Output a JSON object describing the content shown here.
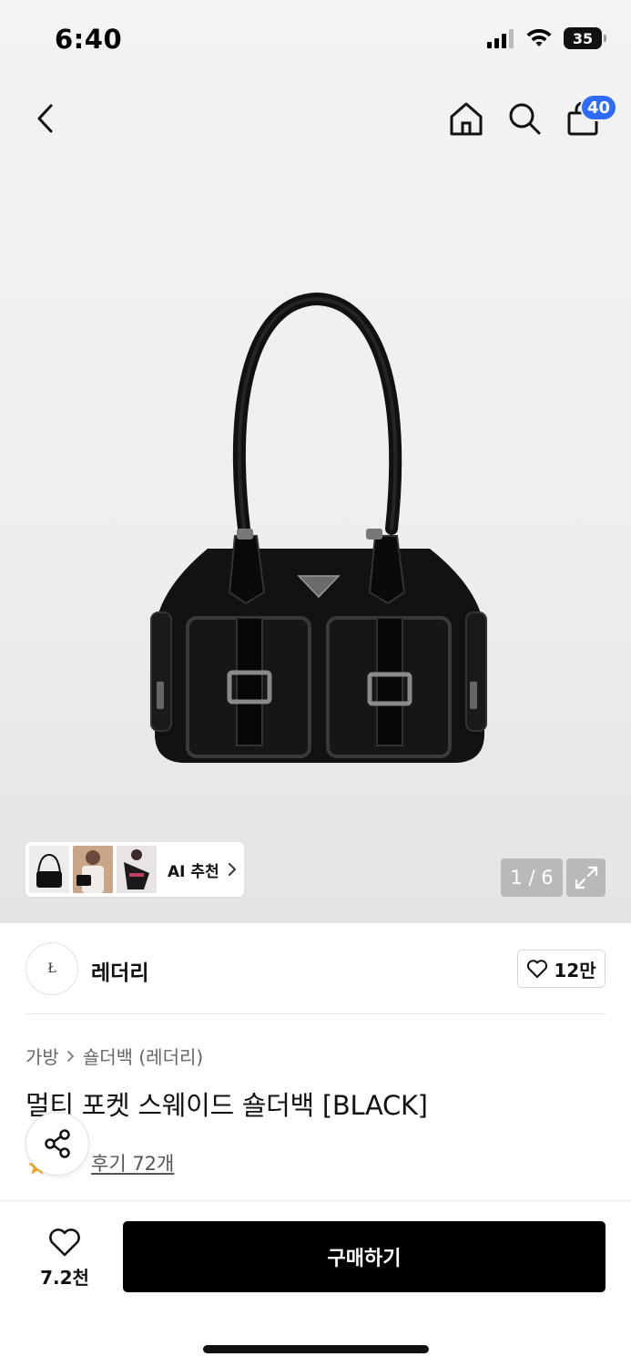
{
  "status_bar": {
    "time": "6:40",
    "battery": "35"
  },
  "nav": {
    "cart_count": "40"
  },
  "gallery": {
    "ai_label": "AI 추천",
    "page_counter": "1 / 6"
  },
  "brand": {
    "logo_text": "Ł",
    "name": "레더리",
    "like_count": "12만"
  },
  "product": {
    "breadcrumb": [
      "가방",
      "숄더백 (레더리)"
    ],
    "title": "멀티 포켓 스웨이드 숄더백 [BLACK]",
    "review_link": "후기 72개"
  },
  "bottom": {
    "wish_count": "7.2천",
    "buy_label": "구매하기"
  },
  "colors": {
    "accent_badge": "#2f6bff",
    "buy_button": "#000000",
    "star": "#f5a623"
  }
}
